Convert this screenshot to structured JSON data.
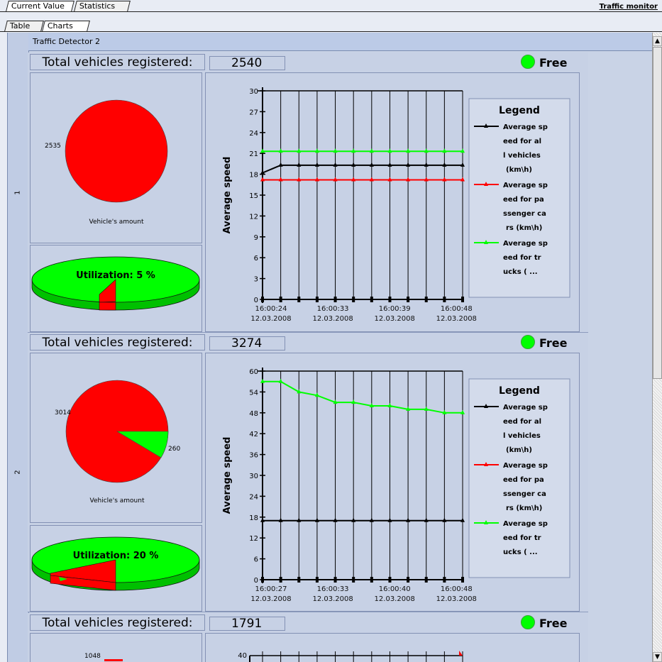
{
  "tabs_top": [
    "Current Value",
    "Statistics"
  ],
  "tabs_sub": [
    "Table",
    "Charts"
  ],
  "header_right": "Traffic monitor",
  "column_header": "Traffic Detector 2",
  "rows": [
    {
      "row_number": "1",
      "title": "Total vehicles registered:",
      "count": "2540",
      "status": "Free",
      "pie": {
        "label_main": "2535",
        "label_minor": "",
        "caption": "Vehicle's amount"
      },
      "utilization": "Utilization: 5 %",
      "chart": {
        "ylabel": "Average speed",
        "yticks": [
          "30",
          "27",
          "24",
          "21",
          "18",
          "15",
          "12",
          "9",
          "6",
          "3",
          "0"
        ],
        "xticks": [
          [
            "16:00:24",
            "12.03.2008"
          ],
          [
            "16:00:33",
            "12.03.2008"
          ],
          [
            "16:00:39",
            "12.03.2008"
          ],
          [
            "16:00:48",
            "12.03.2008"
          ]
        ],
        "legend_title": "Legend",
        "legend": [
          [
            "Average sp",
            "eed for al",
            "l vehicles",
            "(km\\h)"
          ],
          [
            "Average sp",
            "eed for pa",
            "ssenger ca",
            "rs (km\\h)"
          ],
          [
            "Average sp",
            "eed for tr",
            "ucks ( ..."
          ]
        ]
      }
    },
    {
      "row_number": "2",
      "title": "Total vehicles registered:",
      "count": "3274",
      "status": "Free",
      "pie": {
        "label_main": "3014",
        "label_minor": "260",
        "caption": "Vehicle's amount"
      },
      "utilization": "Utilization: 20 %",
      "chart": {
        "ylabel": "Average speed",
        "yticks": [
          "60",
          "54",
          "48",
          "42",
          "36",
          "30",
          "24",
          "18",
          "12",
          "6",
          "0"
        ],
        "xticks": [
          [
            "16:00:27",
            "12.03.2008"
          ],
          [
            "16:00:33",
            "12.03.2008"
          ],
          [
            "16:00:40",
            "12.03.2008"
          ],
          [
            "16:00:48",
            "12.03.2008"
          ]
        ],
        "legend_title": "Legend",
        "legend": [
          [
            "Average sp",
            "eed for al",
            "l vehicles",
            "(km\\h)"
          ],
          [
            "Average sp",
            "eed for pa",
            "ssenger ca",
            "rs (km\\h)"
          ],
          [
            "Average sp",
            "eed for tr",
            "ucks ( ..."
          ]
        ]
      }
    },
    {
      "row_number": "",
      "title": "Total vehicles registered:",
      "count": "1791",
      "status": "Free",
      "pie": {
        "label_main": "1048"
      },
      "chart": {
        "ytick_top": "40"
      }
    }
  ],
  "series_colors": {
    "all": "#000000",
    "cars": "#ff0000",
    "trucks": "#00ff00"
  },
  "chart_data": [
    {
      "type": "line",
      "ylim": [
        0,
        30
      ],
      "series": [
        {
          "name": "Average speed for all vehicles (km\\h)",
          "values": [
            18.2,
            19.3,
            19.3,
            19.3,
            19.3,
            19.3,
            19.3,
            19.3,
            19.3,
            19.3,
            19.3,
            19.3
          ]
        },
        {
          "name": "Average speed for passenger cars (km\\h)",
          "values": [
            17.2,
            17.2,
            17.2,
            17.2,
            17.2,
            17.2,
            17.2,
            17.2,
            17.2,
            17.2,
            17.2,
            17.2
          ]
        },
        {
          "name": "Average speed for trucks",
          "values": [
            21.3,
            21.3,
            21.3,
            21.3,
            21.3,
            21.3,
            21.3,
            21.3,
            21.3,
            21.3,
            21.3,
            21.3
          ]
        }
      ]
    },
    {
      "type": "line",
      "ylim": [
        0,
        60
      ],
      "series": [
        {
          "name": "Average speed for all vehicles (km\\h)",
          "values": [
            17,
            17,
            17,
            17,
            17,
            17,
            17,
            17,
            17,
            17,
            17,
            17
          ]
        },
        {
          "name": "Average speed for passenger cars (km\\h)",
          "values": []
        },
        {
          "name": "Average speed for trucks",
          "values": [
            57,
            57,
            54,
            53,
            51,
            51,
            50,
            50,
            49,
            49,
            48,
            48
          ]
        }
      ]
    }
  ]
}
